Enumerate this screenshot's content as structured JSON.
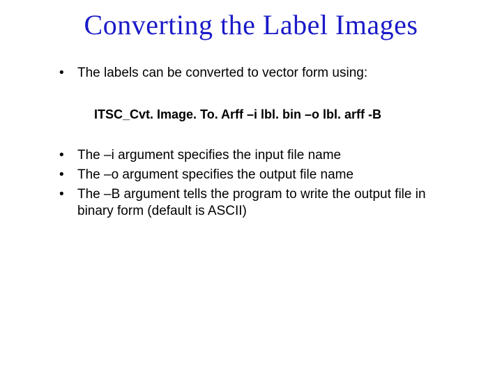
{
  "title_color": "#1a1ac8",
  "title": "Converting the Label Images",
  "bullets_group1": [
    "The labels can be converted to vector form using:"
  ],
  "command": "ITSC_Cvt. Image. To. Arff –i lbl. bin –o lbl. arff -B",
  "bullets_group2": [
    "The –i argument specifies the input file name",
    "The –o argument specifies the output file name",
    "The –B argument tells the program to write the output file in binary form (default is ASCII)"
  ]
}
